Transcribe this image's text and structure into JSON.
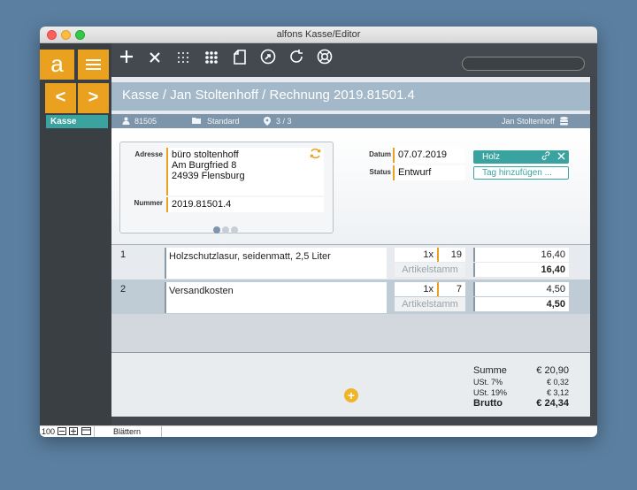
{
  "window": {
    "title": "alfons Kasse/Editor"
  },
  "rail": {
    "logo": "a",
    "prev": "<",
    "next": ">",
    "item": "Kasse"
  },
  "toolbar": {
    "icons": [
      "plus-icon",
      "close-icon",
      "grid-dotted-icon",
      "grid-icon",
      "document-icon",
      "share-icon",
      "refresh-icon",
      "help-icon"
    ],
    "search_placeholder": ""
  },
  "header": {
    "breadcrumb": "Kasse / Jan Stoltenhoff / Rechnung 2019.81501.4"
  },
  "info": {
    "customer_no": "81505",
    "category": "Standard",
    "location": "3 / 3",
    "user": "Jan Stoltenhoff"
  },
  "form": {
    "address_label": "Adresse",
    "address_lines": [
      "büro stoltenhoff",
      "Am Burgfried 8",
      "24939 Flensburg"
    ],
    "number_label": "Nummer",
    "number": "2019.81501.4",
    "date_label": "Datum",
    "date": "07.07.2019",
    "status_label": "Status",
    "status": "Entwurf",
    "tag": "Holz",
    "tag_add": "Tag hinzufügen ..."
  },
  "lines": [
    {
      "pos": "1",
      "desc": "Holzschutzlasur, seidenmatt, 2,5 Liter",
      "qty": "1x",
      "unit": "19",
      "source": "Artikelstamm",
      "amount": "16,40",
      "total": "16,40"
    },
    {
      "pos": "2",
      "desc": "Versandkosten",
      "qty": "1x",
      "unit": "7",
      "source": "Artikelstamm",
      "amount": "4,50",
      "total": "4,50"
    }
  ],
  "summary": {
    "summe_label": "Summe",
    "summe": "€ 20,90",
    "ust7_label": "USt. 7%",
    "ust7": "€ 0,32",
    "ust19_label": "USt. 19%",
    "ust19": "€ 3,12",
    "brutto_label": "Brutto",
    "brutto": "€ 24,34"
  },
  "statusbar": {
    "zoom": "100",
    "mode": "Blättern"
  },
  "colors": {
    "accent": "#e9a11f",
    "teal": "#3aa3a0",
    "header": "#a3b8c8"
  }
}
